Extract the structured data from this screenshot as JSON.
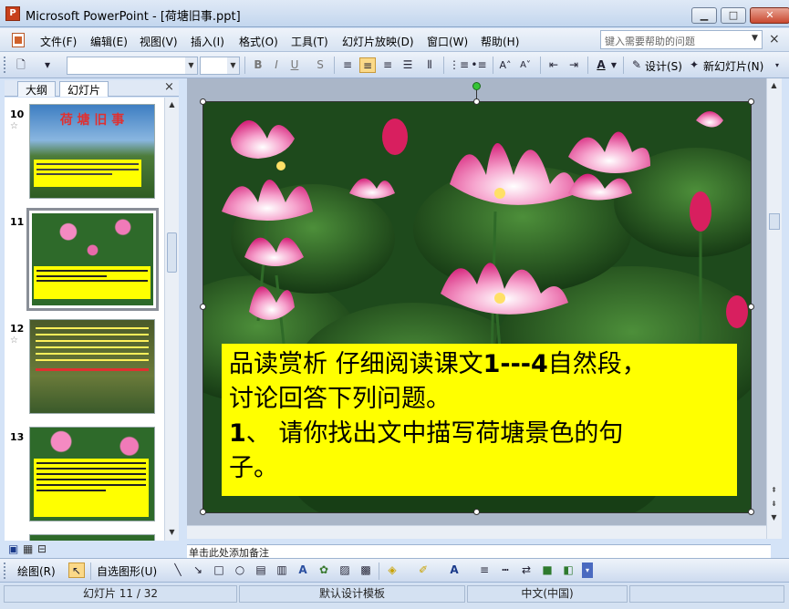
{
  "window": {
    "app_name": "Microsoft PowerPoint",
    "doc_name": "荷塘旧事.ppt",
    "title": "Microsoft PowerPoint - [荷塘旧事.ppt]",
    "min": "▁",
    "max": "□",
    "close": "✕"
  },
  "menu": {
    "items": [
      "文件(F)",
      "编辑(E)",
      "视图(V)",
      "插入(I)",
      "格式(O)",
      "工具(T)",
      "幻灯片放映(D)",
      "窗口(W)",
      "帮助(H)"
    ],
    "help_placeholder": "键入需要帮助的问题",
    "doc_close": "×"
  },
  "toolbar": {
    "design_label": "设计(S)",
    "new_slide_label": "新幻灯片(N)",
    "font_name": "",
    "font_size": "",
    "format_buttons": [
      "B",
      "I",
      "U",
      "S"
    ]
  },
  "panel": {
    "tab_outline": "大纲",
    "tab_slides": "幻灯片",
    "close": "×"
  },
  "thumbnails": [
    {
      "number": "10",
      "star": "☆",
      "title": "荷 塘 旧 事"
    },
    {
      "number": "11",
      "star": ""
    },
    {
      "number": "12",
      "star": "☆"
    },
    {
      "number": "13",
      "star": ""
    }
  ],
  "slide": {
    "line1_a": "品读赏析 仔细阅读课文",
    "line1_b": "1---4",
    "line1_c": "自然段，",
    "line2": "讨论回答下列问题。",
    "line3_a": "1",
    "line3_b": "、 请你找出文中描写荷塘景色的句",
    "line4": "子。"
  },
  "notes": {
    "placeholder": "单击此处添加备注"
  },
  "drawing": {
    "draw_label": "绘图(R)",
    "autoshape_label": "自选图形(U)"
  },
  "status": {
    "slide_pos": "幻灯片 11 / 32",
    "template": "默认设计模板",
    "language": "中文(中国)"
  },
  "colors": {
    "textbox_bg": "#ffff00",
    "title_accent": "#c8401c",
    "selection": "#fbd988"
  }
}
